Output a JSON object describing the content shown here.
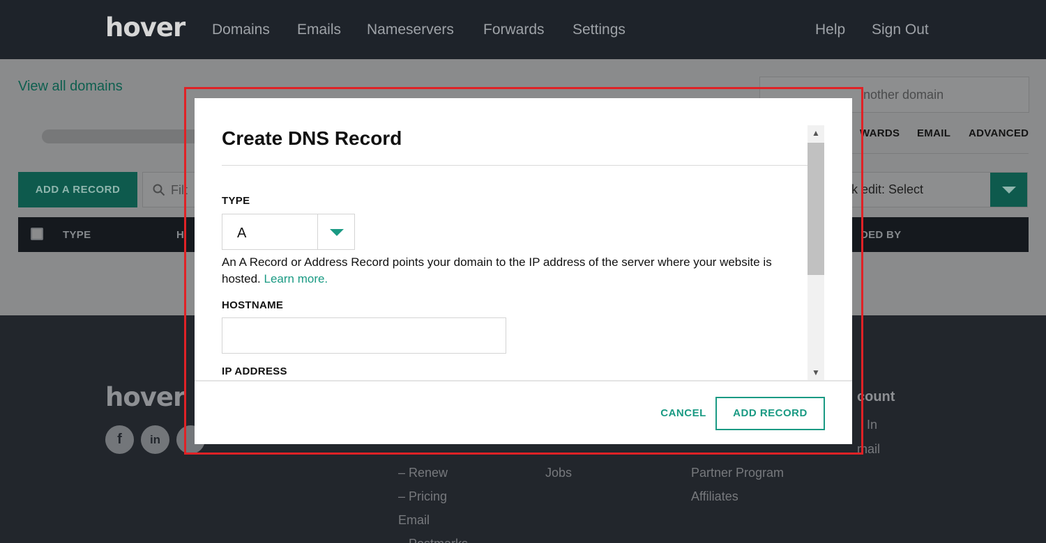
{
  "nav": {
    "logo": "hover",
    "links": [
      "Domains",
      "Emails",
      "Nameservers",
      "Forwards",
      "Settings"
    ],
    "help": "Help",
    "sign_out": "Sign Out"
  },
  "page": {
    "view_all": "View all domains",
    "search_placeholder": "nother domain",
    "tabs": [
      "WARDS",
      "EMAIL",
      "ADVANCED"
    ],
    "add_record_button": "ADD A RECORD",
    "filter_placeholder": "Filt",
    "bulk_edit": "k edit: Select",
    "table_headers": [
      "TYPE",
      "H",
      "DED BY"
    ]
  },
  "footer": {
    "logo": "hover",
    "social": [
      {
        "icon": "facebook-icon",
        "glyph": "f"
      },
      {
        "icon": "linkedin-icon",
        "glyph": "in"
      }
    ],
    "col1": [
      "–  Renew",
      "–  Pricing",
      "Email",
      "–  Postmarks"
    ],
    "col2": [
      "Jobs"
    ],
    "col3": [
      "Partner Program",
      "Affiliates"
    ],
    "col4_head": "count",
    "col4": [
      "In",
      "mail"
    ]
  },
  "modal": {
    "title": "Create DNS Record",
    "type_label": "TYPE",
    "type_value": "A",
    "description": "An A Record or Address Record points your domain to the IP address of the server where your website is hosted.",
    "learn_more": "Learn more.",
    "hostname_label": "HOSTNAME",
    "hostname_value": "",
    "ip_label": "IP ADDRESS",
    "cancel": "CANCEL",
    "add_record": "ADD RECORD"
  },
  "colors": {
    "accent": "#1a9a83",
    "highlight_outline": "#e02226",
    "nav_bg": "#1e232a"
  }
}
